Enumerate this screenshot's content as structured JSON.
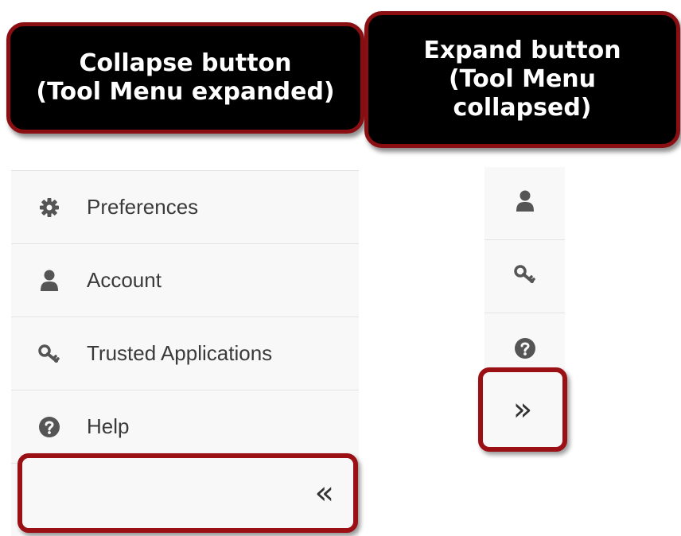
{
  "callouts": {
    "collapse": [
      "Collapse button",
      "(Tool Menu expanded)"
    ],
    "expand": [
      "Expand button",
      "(Tool Menu",
      "collapsed)"
    ]
  },
  "expanded_menu": {
    "items": [
      {
        "label": "Preferences",
        "icon": "gear-icon"
      },
      {
        "label": "Account",
        "icon": "user-icon"
      },
      {
        "label": "Trusted Applications",
        "icon": "key-icon"
      },
      {
        "label": "Help",
        "icon": "question-circle-icon"
      }
    ],
    "collapse_glyph": "«"
  },
  "collapsed_menu": {
    "icons": [
      "user-icon",
      "key-icon",
      "question-circle-icon"
    ],
    "expand_glyph": "»"
  },
  "colors": {
    "callout_bg": "#000000",
    "callout_border": "#8b0e12",
    "highlight_border": "#9b1015",
    "menu_bg": "#f8f8f8",
    "icon": "#555555"
  }
}
